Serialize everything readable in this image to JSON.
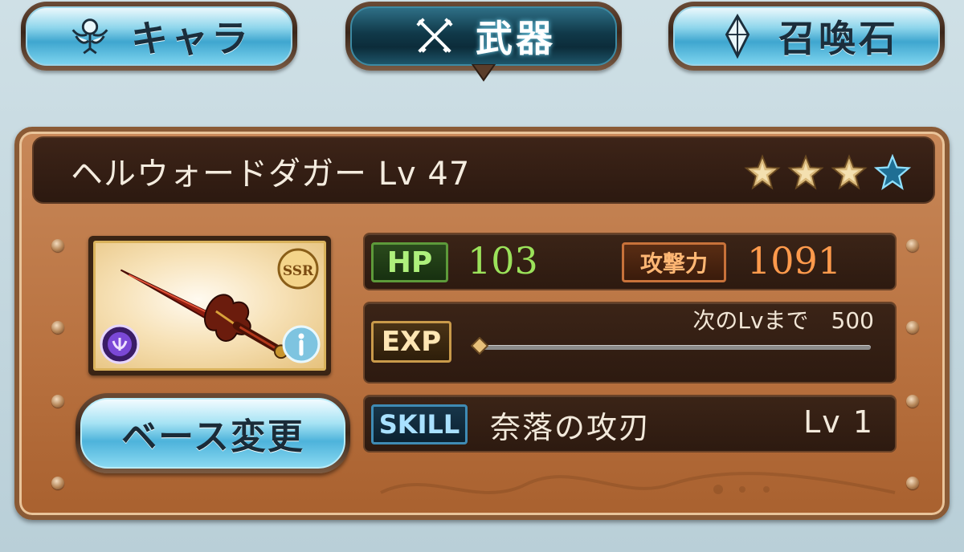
{
  "tabs": [
    {
      "label": "キャラ",
      "icon": "character-icon",
      "active": false
    },
    {
      "label": "武器",
      "icon": "crossed-weapons-icon",
      "active": true
    },
    {
      "label": "召喚石",
      "icon": "summon-crystal-icon",
      "active": false
    }
  ],
  "weapon": {
    "title": "ヘルウォードダガー Lv 47",
    "rarity_badge": "SSR",
    "stars": {
      "filled": 3,
      "total": 4
    },
    "element_icon": "element-orb-icon",
    "info_icon": "info-icon"
  },
  "base_change_button": {
    "label": "ベース変更"
  },
  "stats": {
    "hp_label": "HP",
    "hp_value": "103",
    "atk_label": "攻撃力",
    "atk_value": "1091",
    "exp_label": "EXP",
    "exp_next_text": "次のLvまで　500",
    "exp_progress": 0.02
  },
  "skill": {
    "label": "SKILL",
    "name": "奈落の攻刃",
    "level": "Lv 1"
  },
  "colors": {
    "hp": "#9be25a",
    "atk": "#ff9a4c",
    "tab_active": "#103949",
    "tab_inactive": "#3fa6cf",
    "panel": "#b8713f"
  }
}
